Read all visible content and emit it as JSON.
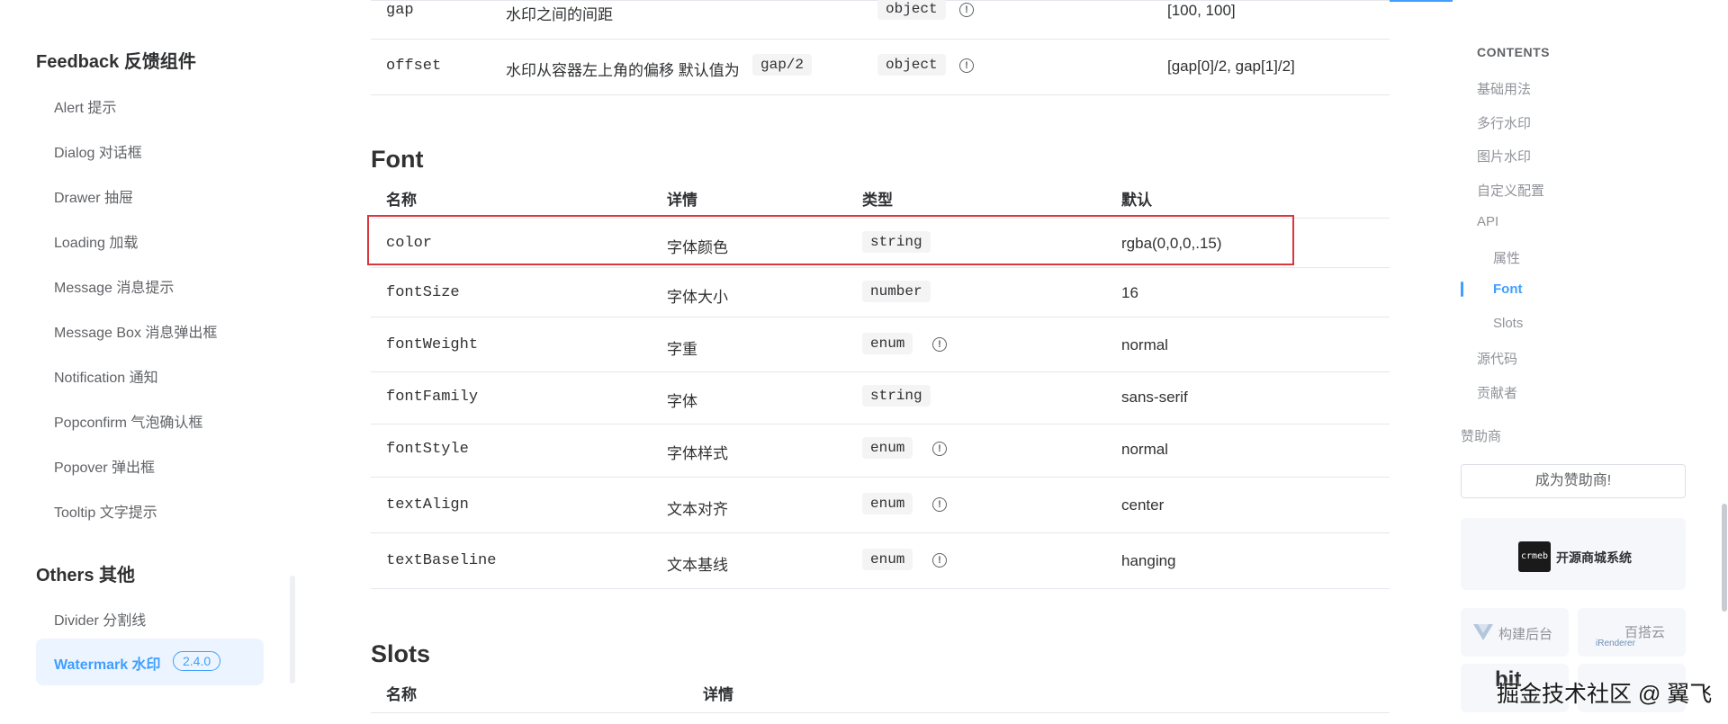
{
  "sidebar": {
    "feedback_group": "Feedback 反馈组件",
    "feedback_items": [
      "Alert 提示",
      "Dialog 对话框",
      "Drawer 抽屉",
      "Loading 加载",
      "Message 消息提示",
      "Message Box 消息弹出框",
      "Notification 通知",
      "Popconfirm 气泡确认框",
      "Popover 弹出框",
      "Tooltip 文字提示"
    ],
    "others_group": "Others 其他",
    "others_items": [
      "Divider 分割线"
    ],
    "active_item": {
      "label": "Watermark 水印",
      "badge": "2.4.0"
    }
  },
  "top_table": {
    "rows": [
      {
        "name": "gap",
        "desc": "水印之间的间距",
        "desc_code": "",
        "type": "object",
        "has_info": true,
        "default": "[100, 100]"
      },
      {
        "name": "offset",
        "desc": "水印从容器左上角的偏移 默认值为",
        "desc_code": "gap/2",
        "type": "object",
        "has_info": true,
        "default": "[gap[0]/2, gap[1]/2]"
      }
    ]
  },
  "font_section": {
    "heading": "Font",
    "headers": {
      "name": "名称",
      "desc": "详情",
      "type": "类型",
      "default": "默认"
    },
    "rows": [
      {
        "name": "color",
        "desc": "字体颜色",
        "type": "string",
        "has_info": false,
        "default": "rgba(0,0,0,.15)"
      },
      {
        "name": "fontSize",
        "desc": "字体大小",
        "type": "number",
        "has_info": false,
        "default": "16"
      },
      {
        "name": "fontWeight",
        "desc": "字重",
        "type": "enum",
        "has_info": true,
        "default": "normal"
      },
      {
        "name": "fontFamily",
        "desc": "字体",
        "type": "string",
        "has_info": false,
        "default": "sans-serif"
      },
      {
        "name": "fontStyle",
        "desc": "字体样式",
        "type": "enum",
        "has_info": true,
        "default": "normal"
      },
      {
        "name": "textAlign",
        "desc": "文本对齐",
        "type": "enum",
        "has_info": true,
        "default": "center"
      },
      {
        "name": "textBaseline",
        "desc": "文本基线",
        "type": "enum",
        "has_info": true,
        "default": "hanging"
      }
    ],
    "highlighted_row": "color"
  },
  "slots_section": {
    "heading": "Slots",
    "headers": {
      "name": "名称",
      "desc": "详情"
    }
  },
  "toc": {
    "title": "CONTENTS",
    "items": [
      {
        "label": "基础用法",
        "level": 1,
        "active": false
      },
      {
        "label": "多行水印",
        "level": 1,
        "active": false
      },
      {
        "label": "图片水印",
        "level": 1,
        "active": false
      },
      {
        "label": "自定义配置",
        "level": 1,
        "active": false
      },
      {
        "label": "API",
        "level": 1,
        "active": false
      },
      {
        "label": "属性",
        "level": 2,
        "active": false
      },
      {
        "label": "Font",
        "level": 2,
        "active": true
      },
      {
        "label": "Slots",
        "level": 2,
        "active": false
      },
      {
        "label": "源代码",
        "level": 1,
        "active": false
      },
      {
        "label": "贡献者",
        "level": 1,
        "active": false
      }
    ],
    "sponsor_label": "赞助商",
    "sponsor_button": "成为赞助商!",
    "sponsors": {
      "crmeb_logo": "crmeb",
      "crmeb": "开源商城系统",
      "vue_admin": "构建后台",
      "baota": "百搭云",
      "irenderer": "iRenderer",
      "bit": "bit"
    }
  },
  "watermark_text": "掘金技术社区 @ 翼飞",
  "colors": {
    "accent": "#409eff",
    "highlight_border": "#d9363e",
    "code_bg": "#f4f4f5",
    "border": "#e4e7ed"
  }
}
